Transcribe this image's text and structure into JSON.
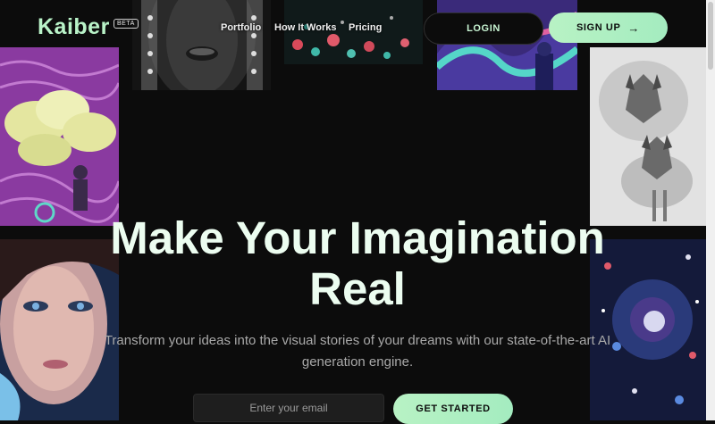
{
  "brand": {
    "logo": "Kaiber",
    "badge": "BETA"
  },
  "nav": {
    "links": [
      "Portfolio",
      "How It Works",
      "Pricing"
    ],
    "login": "LOGIN",
    "signup": "SIGN UP",
    "signup_icon": "arrow-right-icon"
  },
  "hero": {
    "title": "Make Your Imagination Real",
    "subtitle": "Transform your ideas into the visual stories of your dreams with our state-of-the-art AI generation engine."
  },
  "cta": {
    "email_placeholder": "Enter your email",
    "button": "GET STARTED"
  },
  "colors": {
    "background": "#0c0c0c",
    "accent": "#b8f2c4",
    "title": "#ecfdf0",
    "subtitle": "#a9a9a9"
  }
}
